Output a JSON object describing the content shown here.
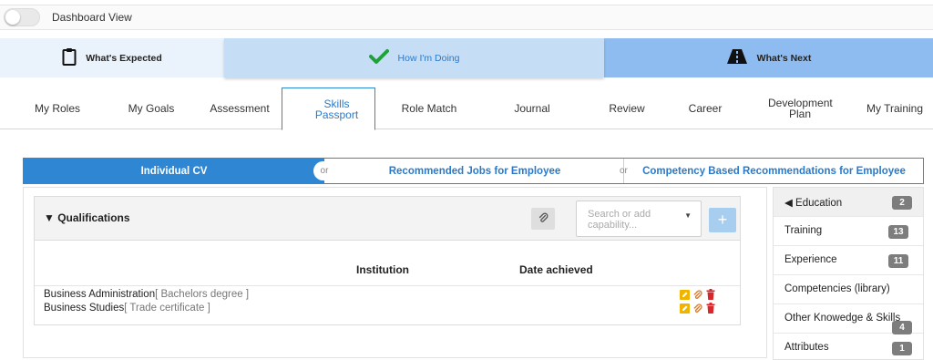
{
  "topbar": {
    "toggle_label": "Dashboard View"
  },
  "stages": [
    {
      "label": "What's Expected",
      "icon": "clipboard-icon"
    },
    {
      "label": "How I'm Doing",
      "icon": "check-icon"
    },
    {
      "label": "What's Next",
      "icon": "road-icon"
    }
  ],
  "nav_tabs": [
    {
      "label": "My Roles"
    },
    {
      "label": "My Goals"
    },
    {
      "label": "Assessment"
    },
    {
      "label": "Skills Passport",
      "active": true
    },
    {
      "label": "Role Match"
    },
    {
      "label": "Journal"
    },
    {
      "label": "Review"
    },
    {
      "label": "Career"
    },
    {
      "label": "Development Plan"
    },
    {
      "label": "My Training"
    }
  ],
  "cv_options": {
    "individual": "Individual CV",
    "or1": "or",
    "recommended": "Recommended Jobs for Employee",
    "or2": "or",
    "competency": "Competency Based Recommendations for Employee"
  },
  "qualifications": {
    "title": "▼ Qualifications",
    "search_placeholder": "Search or add capability...",
    "add_label": "+",
    "columns": [
      "Institution",
      "Date achieved"
    ],
    "rows": [
      {
        "name": "Business Administration",
        "qualifier": "[ Bachelors degree ]"
      },
      {
        "name": "Business Studies",
        "qualifier": "[ Trade certificate ]"
      }
    ]
  },
  "sidebar": {
    "items": [
      {
        "label": "◀ Education",
        "count": "2",
        "active": true
      },
      {
        "label": "Training",
        "count": "13"
      },
      {
        "label": "Experience",
        "count": "11"
      },
      {
        "label": "Competencies (library)",
        "count": ""
      },
      {
        "label": "Other Knowedge & Skills",
        "count": "4"
      },
      {
        "label": "Attributes",
        "count": "1"
      }
    ]
  },
  "colors": {
    "accent_blue": "#2f86d3",
    "stage_active": "#c6ddf6",
    "stage_next": "#8fbcf0",
    "badge_gray": "#7d7d7d",
    "edit_yellow": "#f0b400",
    "delete_red": "#d9262b",
    "check_green": "#1fa23a"
  }
}
